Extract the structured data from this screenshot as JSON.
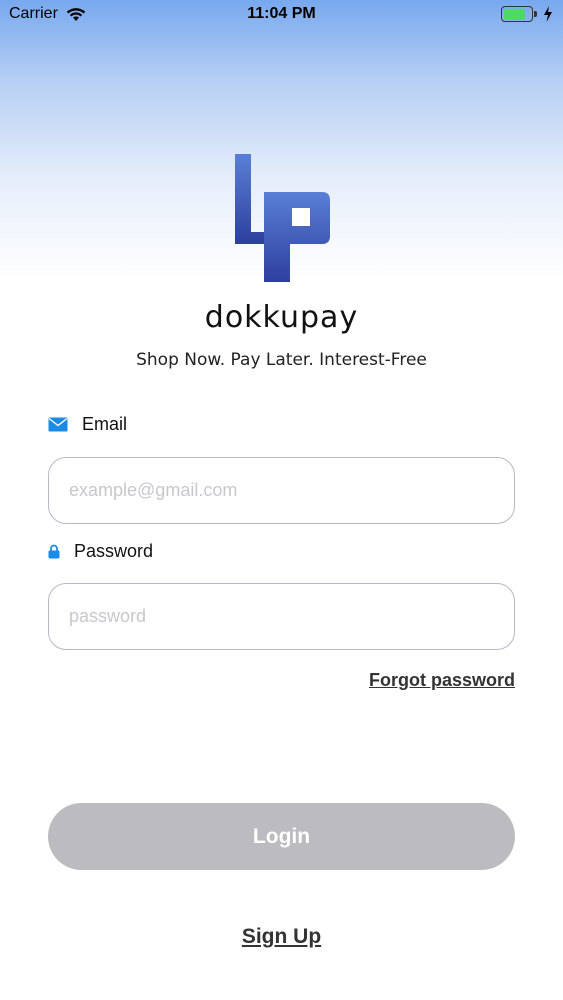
{
  "status_bar": {
    "carrier": "Carrier",
    "time": "11:04 PM",
    "battery_level": 0.8,
    "icons": [
      "wifi-icon",
      "battery-icon",
      "charging-icon"
    ]
  },
  "brand": {
    "name": "dokkupay",
    "tagline": "Shop Now. Pay Later. Interest-Free",
    "logo_color": "#2d3f9e"
  },
  "form": {
    "email_label": "Email",
    "email_placeholder": "example@gmail.com",
    "password_label": "Password",
    "password_placeholder": "password",
    "forgot_password": "Forgot password",
    "login_label": "Login",
    "signup_label": "Sign Up"
  },
  "colors": {
    "accent_icon": "#1a8be6",
    "login_disabled": "#bcbcc0",
    "input_border": "#bdb6c6"
  }
}
